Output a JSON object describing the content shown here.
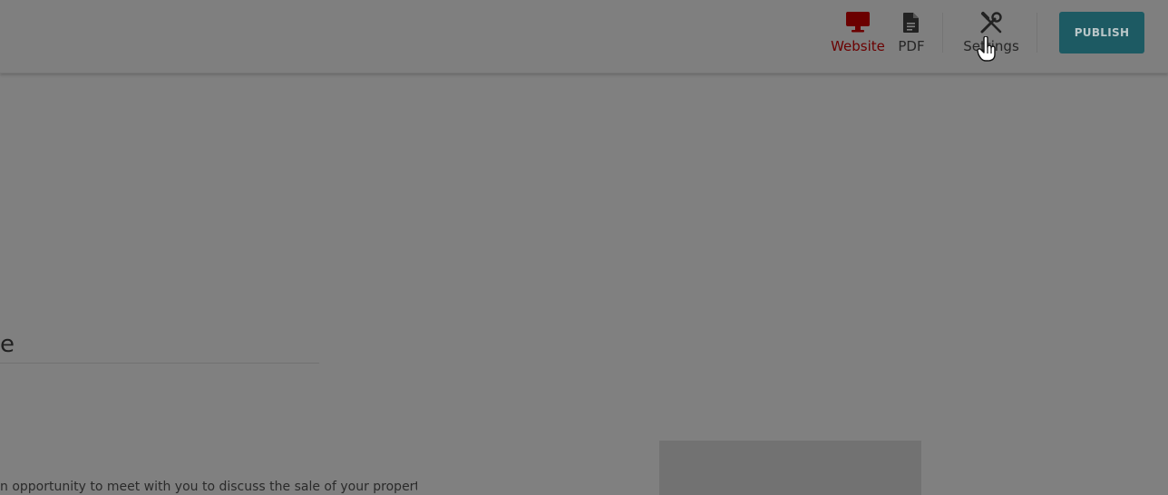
{
  "toolbar": {
    "tabs": [
      {
        "label": "Website",
        "icon": "monitor-icon",
        "active": true
      },
      {
        "label": "PDF",
        "icon": "file-icon",
        "active": false
      },
      {
        "label": "Settings",
        "icon": "tools-icon",
        "active": false
      }
    ],
    "publish_label": "PUBLISH"
  },
  "content": {
    "heading_fragment": "e",
    "body_text": "n opportunity to meet with you to discuss the sale of your property."
  },
  "colors": {
    "active_tab": "#6b0000",
    "publish_button": "#1d5a63",
    "overlay_gray": "#808080"
  }
}
